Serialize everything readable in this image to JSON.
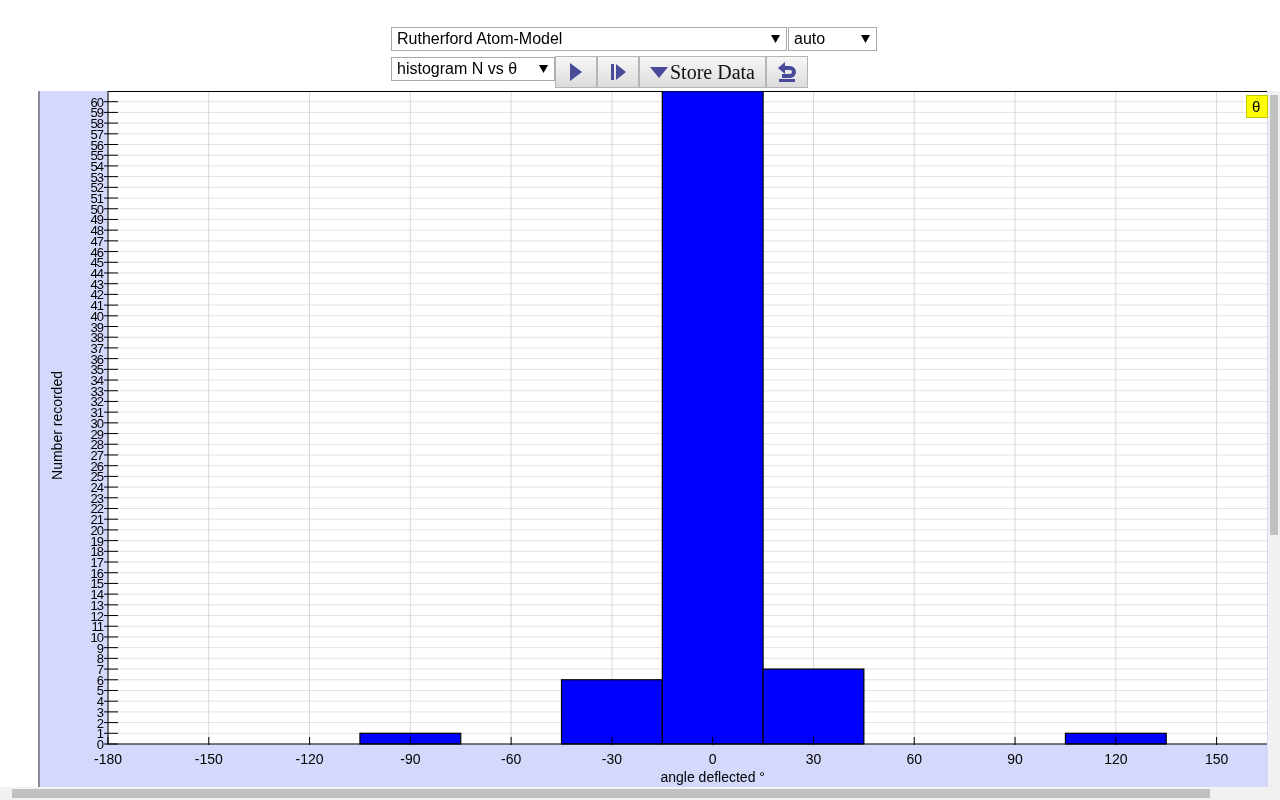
{
  "model_select": {
    "value": "Rutherford Atom-Model"
  },
  "speed_select": {
    "value": "auto"
  },
  "view_select": {
    "value": "histogram N vs θ"
  },
  "toolbar": [
    {
      "kind": "play"
    },
    {
      "kind": "step"
    },
    {
      "kind": "store",
      "label": "Store Data"
    },
    {
      "kind": "undo"
    }
  ],
  "chart": {
    "tooltip": "θ",
    "chart_data": {
      "type": "bar",
      "xlabel": "angle deflected °",
      "ylabel": "Number recorded",
      "x": [
        -180,
        -150,
        -120,
        -90,
        -60,
        -30,
        0,
        30,
        60,
        90,
        120,
        150
      ],
      "values": [
        0,
        0,
        0,
        1,
        0,
        6,
        61,
        7,
        0,
        0,
        1,
        0
      ],
      "xlim": [
        -180,
        165
      ],
      "grid": true,
      "ylim": [
        0,
        61
      ],
      "xticks": [
        -180,
        -150,
        -120,
        -90,
        -60,
        -30,
        0,
        30,
        60,
        90,
        120,
        150
      ],
      "yticks": [
        0,
        1,
        2,
        3,
        4,
        5,
        6,
        7,
        8,
        9,
        10,
        11,
        12,
        13,
        14,
        15,
        16,
        17,
        18,
        19,
        20,
        21,
        22,
        23,
        24,
        25,
        26,
        27,
        28,
        29,
        30,
        31,
        32,
        33,
        34,
        35,
        36,
        37,
        38,
        39,
        40,
        41,
        42,
        43,
        44,
        45,
        46,
        47,
        48,
        49,
        50,
        51,
        52,
        53,
        54,
        55,
        56,
        57,
        58,
        59,
        60
      ]
    }
  }
}
